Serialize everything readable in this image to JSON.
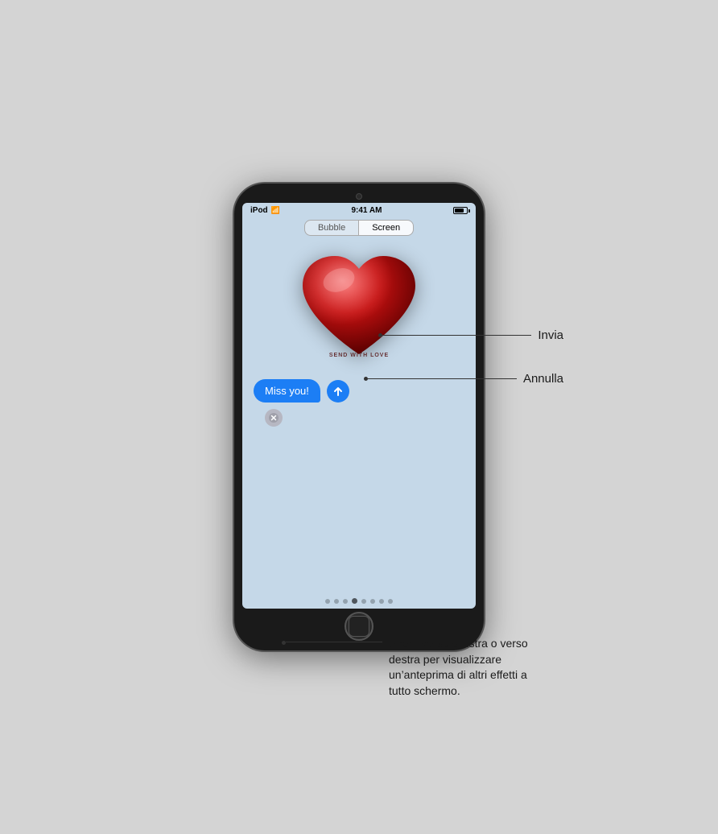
{
  "device": {
    "status_bar": {
      "left": "iPod",
      "wifi": "wifi",
      "time": "9:41 AM",
      "battery": "battery"
    },
    "tabs": [
      {
        "label": "Bubble",
        "active": false
      },
      {
        "label": "Screen",
        "active": true
      }
    ],
    "message": {
      "text": "Miss you!",
      "send_with_love": "SEND WITH LOVE"
    },
    "buttons": {
      "send": "send",
      "cancel": "cancel"
    },
    "page_dots": {
      "count": 8,
      "active_index": 3
    }
  },
  "annotations": {
    "send_label": "Invia",
    "cancel_label": "Annulla",
    "dots_label": "Scorri verso sinistra o verso destra per visualizzare un’anteprima di altri effetti a tutto schermo."
  }
}
